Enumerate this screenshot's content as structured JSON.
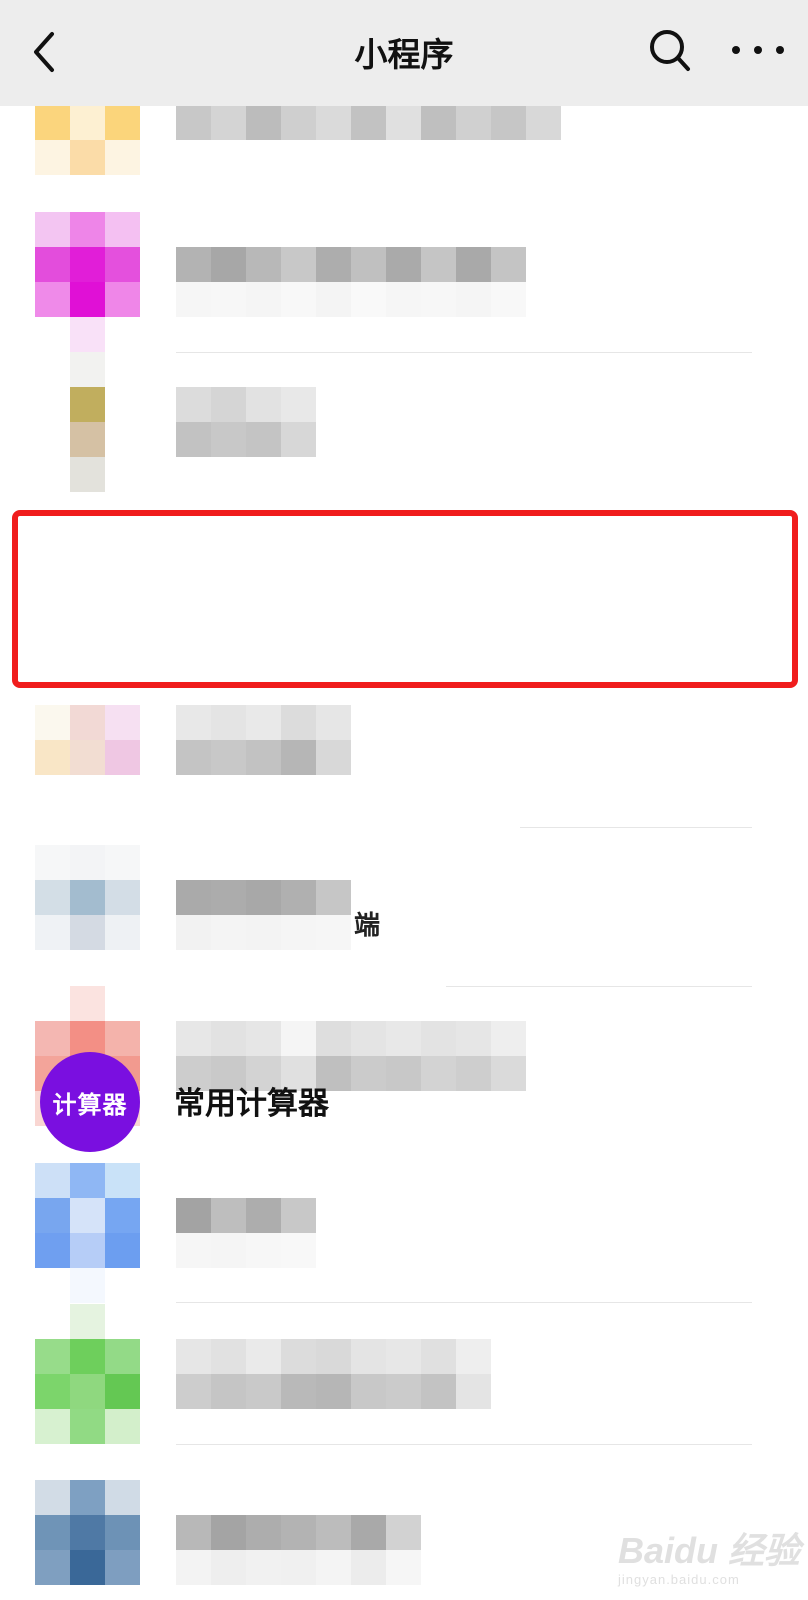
{
  "header": {
    "title": "小程序",
    "back_icon": "back-chevron-icon",
    "search_icon": "search-icon",
    "more_icon": "more-dots-icon"
  },
  "highlighted_item": {
    "icon_text": "计算器",
    "name": "常用计算器",
    "icon_color": "#7a0fe0",
    "border_color": "#f01d1d"
  },
  "stray_glyph": "端",
  "watermark": {
    "brand": "Baidu 经验",
    "url": "jingyan.baidu.com"
  }
}
